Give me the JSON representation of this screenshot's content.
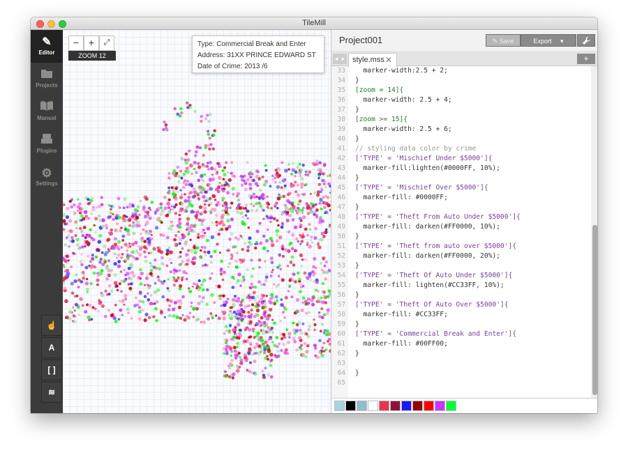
{
  "window": {
    "title": "TileMill"
  },
  "sidebar": {
    "items": [
      {
        "label": "Editor",
        "icon": "pencil-icon",
        "glyph": "✎",
        "active": true
      },
      {
        "label": "Projects",
        "icon": "folder-icon",
        "glyph": "▬",
        "active": false
      },
      {
        "label": "Manual",
        "icon": "book-icon",
        "glyph": "▭",
        "active": false
      },
      {
        "label": "Plugins",
        "icon": "plug-icon",
        "glyph": "▆",
        "active": false
      },
      {
        "label": "Settings",
        "icon": "gear-icon",
        "glyph": "⚙",
        "active": false
      }
    ],
    "tools": [
      {
        "name": "pointer-tool",
        "icon": "hand-pointer-icon",
        "glyph": "☝"
      },
      {
        "name": "fonts-tool",
        "icon": "font-icon",
        "glyph": "A"
      },
      {
        "name": "carto-tool",
        "icon": "brackets-icon",
        "glyph": "[ ]"
      },
      {
        "name": "layers-tool",
        "icon": "layers-icon",
        "glyph": "≋"
      }
    ]
  },
  "map": {
    "zoom_in": "+",
    "zoom_out": "−",
    "fullscreen": "⤢",
    "zoom_label": "ZOOM 12",
    "tooltip": {
      "type": "Type: Commercial Break and Enter",
      "address": "Address: 31XX PRINCE EDWARD ST",
      "date": "Date of Crime: 2013 /6"
    }
  },
  "editor": {
    "project": "Project001",
    "save": "✎ Save",
    "export": "Export",
    "export_caret": "▾",
    "wrench": "🔧",
    "tab": "style.mss",
    "tab_close": "✕",
    "add_tab": "+",
    "prev": "◂",
    "next": "▸",
    "lines": [
      {
        "n": "33",
        "t": "  marker-width:2.5 + 2;"
      },
      {
        "n": "34",
        "t": "}"
      },
      {
        "n": "35",
        "t": "[zoom = 14]{"
      },
      {
        "n": "36",
        "t": "  marker-width: 2.5 + 4;"
      },
      {
        "n": "37",
        "t": "}"
      },
      {
        "n": "38",
        "t": "[zoom >= 15]{"
      },
      {
        "n": "39",
        "t": "  marker-width: 2.5 + 6;"
      },
      {
        "n": "40",
        "t": "}"
      },
      {
        "n": "41",
        "t": "// styling data color by crime"
      },
      {
        "n": "42",
        "t": "['TYPE' = 'Mischief Under $5000']{"
      },
      {
        "n": "43",
        "t": "  marker-fill:lighten(#0000FF, 10%);"
      },
      {
        "n": "44",
        "t": "}"
      },
      {
        "n": "45",
        "t": "['TYPE' = 'Mischief Over $5000']{"
      },
      {
        "n": "46",
        "t": "  marker-fill: #0000FF;"
      },
      {
        "n": "47",
        "t": "}"
      },
      {
        "n": "48",
        "t": "['TYPE' = 'Theft From Auto Under $5000']{"
      },
      {
        "n": "49",
        "t": "  marker-fill: darken(#FF0000, 10%);"
      },
      {
        "n": "50",
        "t": "}"
      },
      {
        "n": "51",
        "t": "['TYPE' = 'Theft from auto over $5000']{"
      },
      {
        "n": "52",
        "t": "  marker-fill: darken(#FF0000, 20%);"
      },
      {
        "n": "53",
        "t": "}"
      },
      {
        "n": "54",
        "t": "['TYPE' = 'Theft Of Auto Under $5000']{"
      },
      {
        "n": "55",
        "t": "  marker-fill: lighten(#CC33FF, 10%);"
      },
      {
        "n": "56",
        "t": "}"
      },
      {
        "n": "57",
        "t": "['TYPE' = 'Theft Of Auto Over $5000']{"
      },
      {
        "n": "58",
        "t": "  marker-fill: #CC33FF;"
      },
      {
        "n": "59",
        "t": "}"
      },
      {
        "n": "60",
        "t": "['TYPE' = 'Commercial Break and Enter']{"
      },
      {
        "n": "61",
        "t": "  marker-fill: #00FF00;"
      },
      {
        "n": "62",
        "t": "}"
      },
      {
        "n": "63",
        "t": ""
      },
      {
        "n": "64",
        "t": "}"
      },
      {
        "n": "65",
        "t": ""
      }
    ],
    "palette": [
      "#a8d4e0",
      "#000000",
      "#8fbdd0",
      "#ffffff",
      "#e8344e",
      "#8b1238",
      "#1a1aff",
      "#990000",
      "#ff0000",
      "#cc33ff",
      "#00ff33"
    ]
  },
  "colors": {
    "sidebar_bg": "#3b3b3b",
    "marker_colors": [
      "#cc33ff",
      "#e64dff",
      "#cc0000",
      "#e6194b",
      "#ff5c8a",
      "#3333ff",
      "#00ff00",
      "#99e699",
      "#ff99cc"
    ]
  }
}
